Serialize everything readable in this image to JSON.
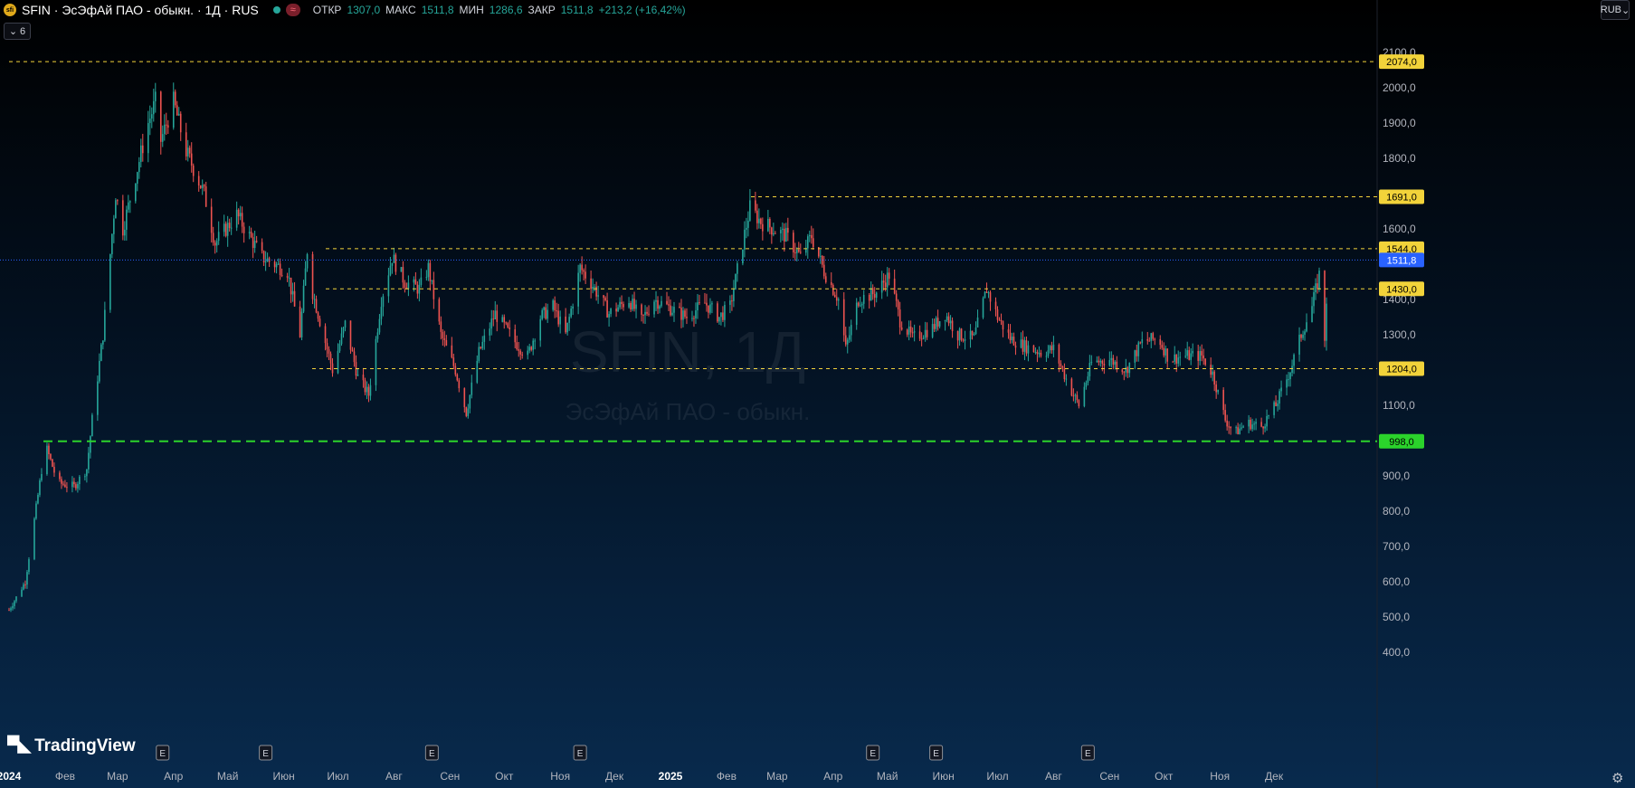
{
  "header": {
    "logo_text": "sfi",
    "symbol": "SFIN · ЭсЭфАй ПАО - обыкн. · 1Д · RUS",
    "approx_glyph": "≈",
    "ohlc": [
      {
        "label": "ОТКР",
        "value": "1307,0"
      },
      {
        "label": "МАКС",
        "value": "1511,8"
      },
      {
        "label": "МИН",
        "value": "1286,6"
      },
      {
        "label": "ЗАКР",
        "value": "1511,8"
      },
      {
        "label": "",
        "value": "+213,2 (+16,42%)"
      }
    ]
  },
  "indicators_toggle": {
    "icon": "chevron-down-icon",
    "count": "6"
  },
  "currency": "RUB",
  "branding": "TradingView",
  "watermark": {
    "ticker": "SFIN, 1Д",
    "name": "ЭсЭфАй ПАО - обыкн."
  },
  "colors": {
    "up": "#26a69a",
    "down": "#ef5350",
    "level": "#f2d33a",
    "support": "#2bd32b",
    "price": "#2962ff"
  },
  "chart_data": {
    "type": "candlestick",
    "ylim": [
      400,
      2100
    ],
    "y_ticks": [
      "2100,0",
      "2000,0",
      "1900,0",
      "1800,0",
      "1600,0",
      "1400,0",
      "1300,0",
      "1100,0",
      "900,0",
      "800,0",
      "700,0",
      "600,0",
      "500,0",
      "400,0"
    ],
    "x_ticks": [
      "2024",
      "Фев",
      "Мар",
      "Апр",
      "Май",
      "Июн",
      "Июл",
      "Авг",
      "Сен",
      "Окт",
      "Ноя",
      "Дек",
      "2025",
      "Фев",
      "Мар",
      "Апр",
      "Май",
      "Июн",
      "Июл",
      "Авг",
      "Сен",
      "Окт",
      "Ноя",
      "Дек"
    ],
    "earnings_markers": [
      "E",
      "E",
      "E",
      "E",
      "E",
      "E",
      "E"
    ],
    "horizontal_levels": [
      {
        "label": "2074,0",
        "value": 2074,
        "style": "dashed",
        "color": "#f2d33a"
      },
      {
        "label": "1691,0",
        "value": 1691,
        "style": "dashed",
        "color": "#f2d33a"
      },
      {
        "label": "1544,0",
        "value": 1544,
        "style": "dashed",
        "color": "#f2d33a"
      },
      {
        "label": "1430,0",
        "value": 1430,
        "style": "dashed",
        "color": "#f2d33a"
      },
      {
        "label": "1204,0",
        "value": 1204,
        "style": "dashed",
        "color": "#f2d33a"
      },
      {
        "label": "998,0",
        "value": 998,
        "style": "long-dashed",
        "color": "#2bd32b"
      }
    ],
    "last_price": {
      "label": "1511,8",
      "value": 1511.8
    },
    "price_path": [
      {
        "date": "2024-01-01",
        "close": 520
      },
      {
        "date": "2024-01-10",
        "close": 600
      },
      {
        "date": "2024-01-18",
        "close": 880
      },
      {
        "date": "2024-01-21",
        "close": 990
      },
      {
        "date": "2024-01-28",
        "close": 880
      },
      {
        "date": "2024-02-06",
        "close": 870
      },
      {
        "date": "2024-02-13",
        "close": 920
      },
      {
        "date": "2024-02-16",
        "close": 1060
      },
      {
        "date": "2024-02-22",
        "close": 1300
      },
      {
        "date": "2024-02-29",
        "close": 1700
      },
      {
        "date": "2024-03-04",
        "close": 1600
      },
      {
        "date": "2024-03-11",
        "close": 1750
      },
      {
        "date": "2024-03-18",
        "close": 1900
      },
      {
        "date": "2024-03-22",
        "close": 1960
      },
      {
        "date": "2024-03-25",
        "close": 1850
      },
      {
        "date": "2024-04-01",
        "close": 1960
      },
      {
        "date": "2024-04-08",
        "close": 1820
      },
      {
        "date": "2024-04-18",
        "close": 1700
      },
      {
        "date": "2024-04-24",
        "close": 1560
      },
      {
        "date": "2024-05-06",
        "close": 1640
      },
      {
        "date": "2024-05-20",
        "close": 1520
      },
      {
        "date": "2024-06-03",
        "close": 1480
      },
      {
        "date": "2024-06-10",
        "close": 1300
      },
      {
        "date": "2024-06-14",
        "close": 1540
      },
      {
        "date": "2024-06-17",
        "close": 1420
      },
      {
        "date": "2024-06-28",
        "close": 1200
      },
      {
        "date": "2024-07-05",
        "close": 1330
      },
      {
        "date": "2024-07-12",
        "close": 1180
      },
      {
        "date": "2024-07-18",
        "close": 1130
      },
      {
        "date": "2024-07-25",
        "close": 1400
      },
      {
        "date": "2024-07-31",
        "close": 1520
      },
      {
        "date": "2024-08-07",
        "close": 1450
      },
      {
        "date": "2024-08-15",
        "close": 1430
      },
      {
        "date": "2024-08-20",
        "close": 1490
      },
      {
        "date": "2024-08-27",
        "close": 1300
      },
      {
        "date": "2024-09-04",
        "close": 1200
      },
      {
        "date": "2024-09-10",
        "close": 1080
      },
      {
        "date": "2024-09-17",
        "close": 1250
      },
      {
        "date": "2024-09-26",
        "close": 1360
      },
      {
        "date": "2024-10-07",
        "close": 1280
      },
      {
        "date": "2024-10-14",
        "close": 1240
      },
      {
        "date": "2024-10-21",
        "close": 1350
      },
      {
        "date": "2024-10-28",
        "close": 1380
      },
      {
        "date": "2024-11-04",
        "close": 1300
      },
      {
        "date": "2024-11-12",
        "close": 1490
      },
      {
        "date": "2024-11-19",
        "close": 1440
      },
      {
        "date": "2024-11-28",
        "close": 1360
      },
      {
        "date": "2024-12-09",
        "close": 1400
      },
      {
        "date": "2024-12-16",
        "close": 1340
      },
      {
        "date": "2024-12-23",
        "close": 1400
      },
      {
        "date": "2025-01-10",
        "close": 1350
      },
      {
        "date": "2025-01-20",
        "close": 1390
      },
      {
        "date": "2025-01-28",
        "close": 1350
      },
      {
        "date": "2025-02-03",
        "close": 1380
      },
      {
        "date": "2025-02-10",
        "close": 1560
      },
      {
        "date": "2025-02-14",
        "close": 1660
      },
      {
        "date": "2025-02-20",
        "close": 1620
      },
      {
        "date": "2025-02-27",
        "close": 1600
      },
      {
        "date": "2025-03-06",
        "close": 1580
      },
      {
        "date": "2025-03-14",
        "close": 1520
      },
      {
        "date": "2025-03-20",
        "close": 1580
      },
      {
        "date": "2025-03-27",
        "close": 1480
      },
      {
        "date": "2025-04-04",
        "close": 1400
      },
      {
        "date": "2025-04-08",
        "close": 1260
      },
      {
        "date": "2025-04-15",
        "close": 1400
      },
      {
        "date": "2025-04-25",
        "close": 1420
      },
      {
        "date": "2025-05-02",
        "close": 1470
      },
      {
        "date": "2025-05-08",
        "close": 1340
      },
      {
        "date": "2025-05-15",
        "close": 1290
      },
      {
        "date": "2025-05-26",
        "close": 1320
      },
      {
        "date": "2025-06-02",
        "close": 1360
      },
      {
        "date": "2025-06-09",
        "close": 1300
      },
      {
        "date": "2025-06-18",
        "close": 1290
      },
      {
        "date": "2025-06-25",
        "close": 1430
      },
      {
        "date": "2025-07-01",
        "close": 1350
      },
      {
        "date": "2025-07-08",
        "close": 1290
      },
      {
        "date": "2025-07-15",
        "close": 1270
      },
      {
        "date": "2025-07-25",
        "close": 1250
      },
      {
        "date": "2025-08-01",
        "close": 1260
      },
      {
        "date": "2025-08-10",
        "close": 1150
      },
      {
        "date": "2025-08-15",
        "close": 1100
      },
      {
        "date": "2025-08-22",
        "close": 1220
      },
      {
        "date": "2025-09-01",
        "close": 1230
      },
      {
        "date": "2025-09-10",
        "close": 1200
      },
      {
        "date": "2025-09-19",
        "close": 1280
      },
      {
        "date": "2025-09-28",
        "close": 1290
      },
      {
        "date": "2025-10-04",
        "close": 1230
      },
      {
        "date": "2025-10-12",
        "close": 1240
      },
      {
        "date": "2025-10-22",
        "close": 1240
      },
      {
        "date": "2025-10-28",
        "close": 1190
      },
      {
        "date": "2025-11-04",
        "close": 1060
      },
      {
        "date": "2025-11-09",
        "close": 1020
      },
      {
        "date": "2025-11-16",
        "close": 1050
      },
      {
        "date": "2025-11-24",
        "close": 1040
      },
      {
        "date": "2025-12-02",
        "close": 1100
      },
      {
        "date": "2025-12-10",
        "close": 1200
      },
      {
        "date": "2025-12-16",
        "close": 1300
      },
      {
        "date": "2025-12-22",
        "close": 1380
      },
      {
        "date": "2025-12-26",
        "close": 1470
      },
      {
        "date": "2025-12-29",
        "close": 1290
      },
      {
        "date": "2025-12-31",
        "close": 1511.8
      }
    ]
  }
}
